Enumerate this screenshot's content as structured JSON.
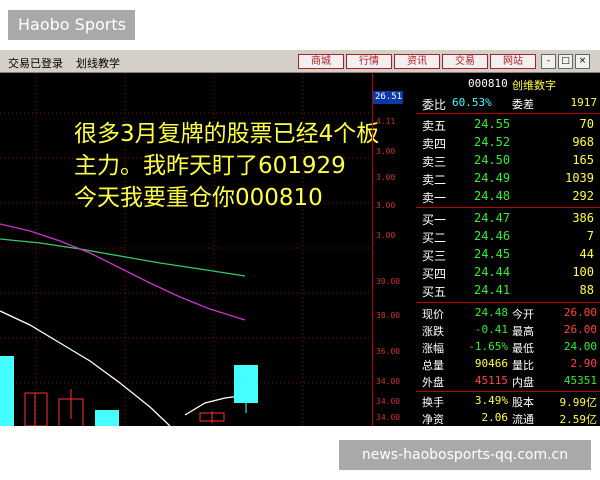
{
  "brand": "Haobo Sports",
  "watermark": "news-haobosports-qq.com.cn",
  "menubar": {
    "items": [
      "交易已登录",
      "划线教学"
    ],
    "buttons": [
      "商城",
      "行情",
      "资讯",
      "交易",
      "网站"
    ],
    "window_controls": [
      "-",
      "□",
      "×"
    ]
  },
  "overlay_text": [
    "很多3月复牌的股票已经4个板",
    "主力。我昨天盯了601929",
    "今天我要重仓你000810"
  ],
  "axis": {
    "current_price": "26.51",
    "ticks": [
      "4.11",
      "3.00",
      "3.00",
      "3.00",
      "3.00",
      "30.00",
      "38.00",
      "36.00",
      "34.00",
      "34.00",
      "34.00"
    ]
  },
  "quote": {
    "code": "000810",
    "name": "创维数字",
    "header_row": {
      "label1": "委比",
      "value1": "60.53%",
      "label2": "委差",
      "value2": "1917"
    },
    "asks": [
      {
        "label": "卖五",
        "price": "24.55",
        "vol": "70"
      },
      {
        "label": "卖四",
        "price": "24.52",
        "vol": "968"
      },
      {
        "label": "卖三",
        "price": "24.50",
        "vol": "165"
      },
      {
        "label": "卖二",
        "price": "24.49",
        "vol": "1039"
      },
      {
        "label": "卖一",
        "price": "24.48",
        "vol": "292"
      }
    ],
    "bids": [
      {
        "label": "买一",
        "price": "24.47",
        "vol": "386"
      },
      {
        "label": "买二",
        "price": "24.46",
        "vol": "7"
      },
      {
        "label": "买三",
        "price": "24.45",
        "vol": "44"
      },
      {
        "label": "买四",
        "price": "24.44",
        "vol": "100"
      },
      {
        "label": "买五",
        "price": "24.41",
        "vol": "88"
      }
    ],
    "stats": [
      {
        "l1": "现价",
        "v1": "24.48",
        "l2": "今开",
        "v2": "26.00"
      },
      {
        "l1": "涨跌",
        "v1": "-0.41",
        "l2": "最高",
        "v2": "26.00"
      },
      {
        "l1": "涨幅",
        "v1": "-1.65%",
        "l2": "最低",
        "v2": "24.00"
      },
      {
        "l1": "总量",
        "v1": "90466",
        "l2": "量比",
        "v2": "2.90"
      },
      {
        "l1": "外盘",
        "v1": "45115",
        "l2": "内盘",
        "v2": "45351"
      },
      {
        "l1": "换手",
        "v1": "3.49%",
        "l2": "股本",
        "v2": "9.99亿"
      },
      {
        "l1": "净资",
        "v1": "2.06",
        "l2": "流通",
        "v2": "2.59亿"
      }
    ]
  },
  "colors": {
    "up": "#ff4444",
    "down": "#33ee33",
    "candle_down": "#44ffff",
    "ma_magenta": "#cc33cc",
    "ma_green": "#33cc66",
    "ma_white": "#ffffff"
  }
}
